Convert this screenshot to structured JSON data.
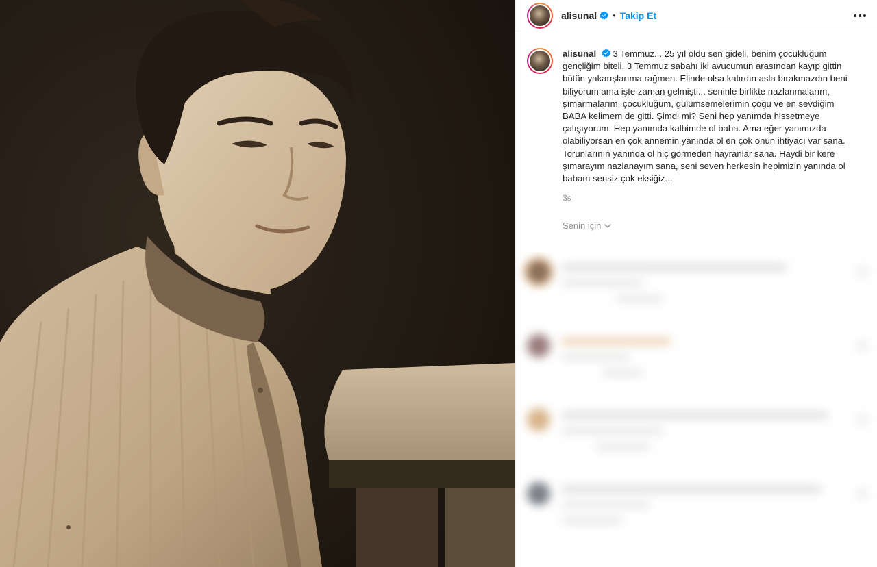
{
  "header": {
    "username": "alisunal",
    "separator": "•",
    "follow_label": "Takip Et",
    "more_icon": "more-horizontal-icon",
    "verified_icon": "verified-badge-icon"
  },
  "caption": {
    "username": "alisunal",
    "text": "3 Temmuz... 25 yıl oldu sen gideli, benim çocukluğum gençliğim biteli. 3 Temmuz sabahı iki avucumun arasından kayıp gittin bütün yakarışlarıma rağmen. Elinde olsa kalırdın asla bırakmazdın beni biliyorum ama işte zaman gelmişti... seninle birlikte nazlanmalarım, şımarmalarım, çocukluğum, gülümsemelerimin çoğu ve en sevdiğim BABA kelimem de gitti. Şimdi mi? Seni hep yanımda hissetmeye çalışıyorum. Hep yanımda kalbimde ol baba. Ama eğer yanımızda olabiliyorsan en çok annemin yanında ol en çok onun ihtiyacı var sana. Torunlarının yanında ol hiç görmeden hayranlar sana. Haydi bir kere şımarayım nazlanayım sana, seni seven herkesin hepimizin yanında ol babam sensiz çok eksiğiz...",
    "time": "3s"
  },
  "comments_filter": {
    "label": "Senin için",
    "icon": "chevron-down-icon"
  },
  "colors": {
    "link": "#0095f6",
    "text": "#262626",
    "muted": "#8e8e8e",
    "verified": "#0095f6"
  }
}
